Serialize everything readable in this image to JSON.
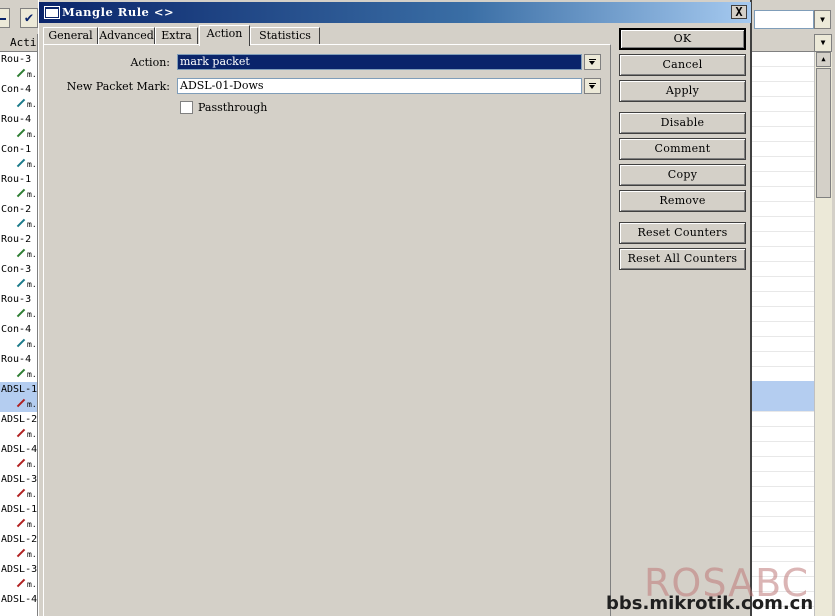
{
  "dialog": {
    "title": "Mangle Rule <>",
    "close_label": "X",
    "tabs": [
      {
        "label": "General"
      },
      {
        "label": "Advanced"
      },
      {
        "label": "Extra"
      },
      {
        "label": "Action"
      },
      {
        "label": "Statistics"
      }
    ],
    "active_tab": "Action",
    "form": {
      "action_label": "Action:",
      "action_value": "mark packet",
      "packet_mark_label": "New Packet Mark:",
      "packet_mark_value": "ADSL-01-Dows",
      "passthrough_label": "Passthrough",
      "passthrough_checked": false
    },
    "buttons": {
      "ok": "OK",
      "cancel": "Cancel",
      "apply": "Apply",
      "disable": "Disable",
      "comment": "Comment",
      "copy": "Copy",
      "remove": "Remove",
      "reset_counters": "Reset Counters",
      "reset_all_counters": "Reset All Counters"
    }
  },
  "background_list": {
    "column_header": "Acti",
    "rows": [
      {
        "label": "Rou-3",
        "kind": "text"
      },
      {
        "label": "m.",
        "kind": "pen",
        "color": "green"
      },
      {
        "label": "Con-4",
        "kind": "text"
      },
      {
        "label": "m.",
        "kind": "pen",
        "color": "teal"
      },
      {
        "label": "Rou-4",
        "kind": "text"
      },
      {
        "label": "m.",
        "kind": "pen",
        "color": "green"
      },
      {
        "label": "Con-1",
        "kind": "text"
      },
      {
        "label": "m.",
        "kind": "pen",
        "color": "teal"
      },
      {
        "label": "Rou-1",
        "kind": "text"
      },
      {
        "label": "m.",
        "kind": "pen",
        "color": "green"
      },
      {
        "label": "Con-2",
        "kind": "text"
      },
      {
        "label": "m.",
        "kind": "pen",
        "color": "teal"
      },
      {
        "label": "Rou-2",
        "kind": "text"
      },
      {
        "label": "m.",
        "kind": "pen",
        "color": "green"
      },
      {
        "label": "Con-3",
        "kind": "text"
      },
      {
        "label": "m.",
        "kind": "pen",
        "color": "teal"
      },
      {
        "label": "Rou-3",
        "kind": "text"
      },
      {
        "label": "m.",
        "kind": "pen",
        "color": "green"
      },
      {
        "label": "Con-4",
        "kind": "text"
      },
      {
        "label": "m.",
        "kind": "pen",
        "color": "teal"
      },
      {
        "label": "Rou-4",
        "kind": "text"
      },
      {
        "label": "m.",
        "kind": "pen",
        "color": "green"
      },
      {
        "label": "ADSL-1",
        "kind": "text",
        "selected": true
      },
      {
        "label": "m.",
        "kind": "pen",
        "color": "red",
        "selected": true
      },
      {
        "label": "ADSL-2",
        "kind": "text"
      },
      {
        "label": "m.",
        "kind": "pen",
        "color": "red"
      },
      {
        "label": "ADSL-4",
        "kind": "text"
      },
      {
        "label": "m.",
        "kind": "pen",
        "color": "red"
      },
      {
        "label": "ADSL-3",
        "kind": "text"
      },
      {
        "label": "m.",
        "kind": "pen",
        "color": "red"
      },
      {
        "label": "ADSL-1",
        "kind": "text"
      },
      {
        "label": "m.",
        "kind": "pen",
        "color": "red"
      },
      {
        "label": "ADSL-2",
        "kind": "text"
      },
      {
        "label": "m.",
        "kind": "pen",
        "color": "red"
      },
      {
        "label": "ADSL-3",
        "kind": "text"
      },
      {
        "label": "m.",
        "kind": "pen",
        "color": "red"
      },
      {
        "label": "ADSL-4",
        "kind": "text"
      }
    ]
  },
  "watermark": {
    "logo": "ROSABC",
    "url": "bbs.mikrotik.com.cn"
  },
  "colors": {
    "title_bar": "#0a246a",
    "selection": "#0a246a",
    "row_highlight": "#b4cdf0",
    "face": "#d4d0c8"
  }
}
